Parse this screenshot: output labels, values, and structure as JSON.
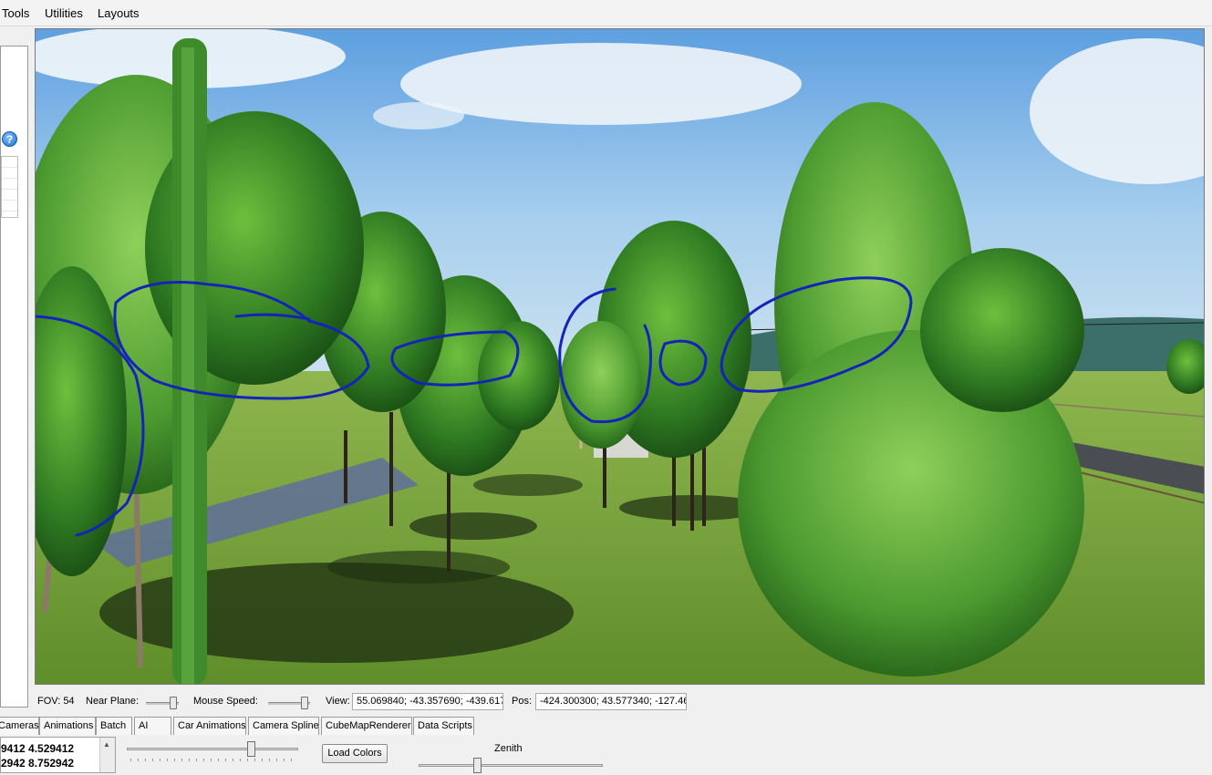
{
  "menu": {
    "tools": "Tools",
    "utilities": "Utilities",
    "layouts": "Layouts"
  },
  "left_panel": {
    "help_label": "?"
  },
  "status": {
    "fov": "FOV: 54",
    "near_plane_label": "Near Plane:",
    "mouse_speed_label": "Mouse Speed:",
    "view_label": "View:",
    "view_value": "55.069840; -43.357690; -439.617",
    "pos_label": "Pos:",
    "pos_value": "-424.300300; 43.577340; -127.46"
  },
  "tabs": [
    "Cameras",
    "Animations",
    "Batch",
    "AI",
    "Car Animations",
    "Camera Spline",
    "CubeMapRenderer",
    "Data Scripts"
  ],
  "bottom": {
    "list_rows": [
      "9412 4.529412",
      "2942 8.752942"
    ],
    "load_colors": "Load Colors",
    "zenith_label": "Zenith"
  },
  "colors": {
    "sky": "#8fc0ea",
    "grass": "#79a83a",
    "annotation": "#1424b8"
  }
}
